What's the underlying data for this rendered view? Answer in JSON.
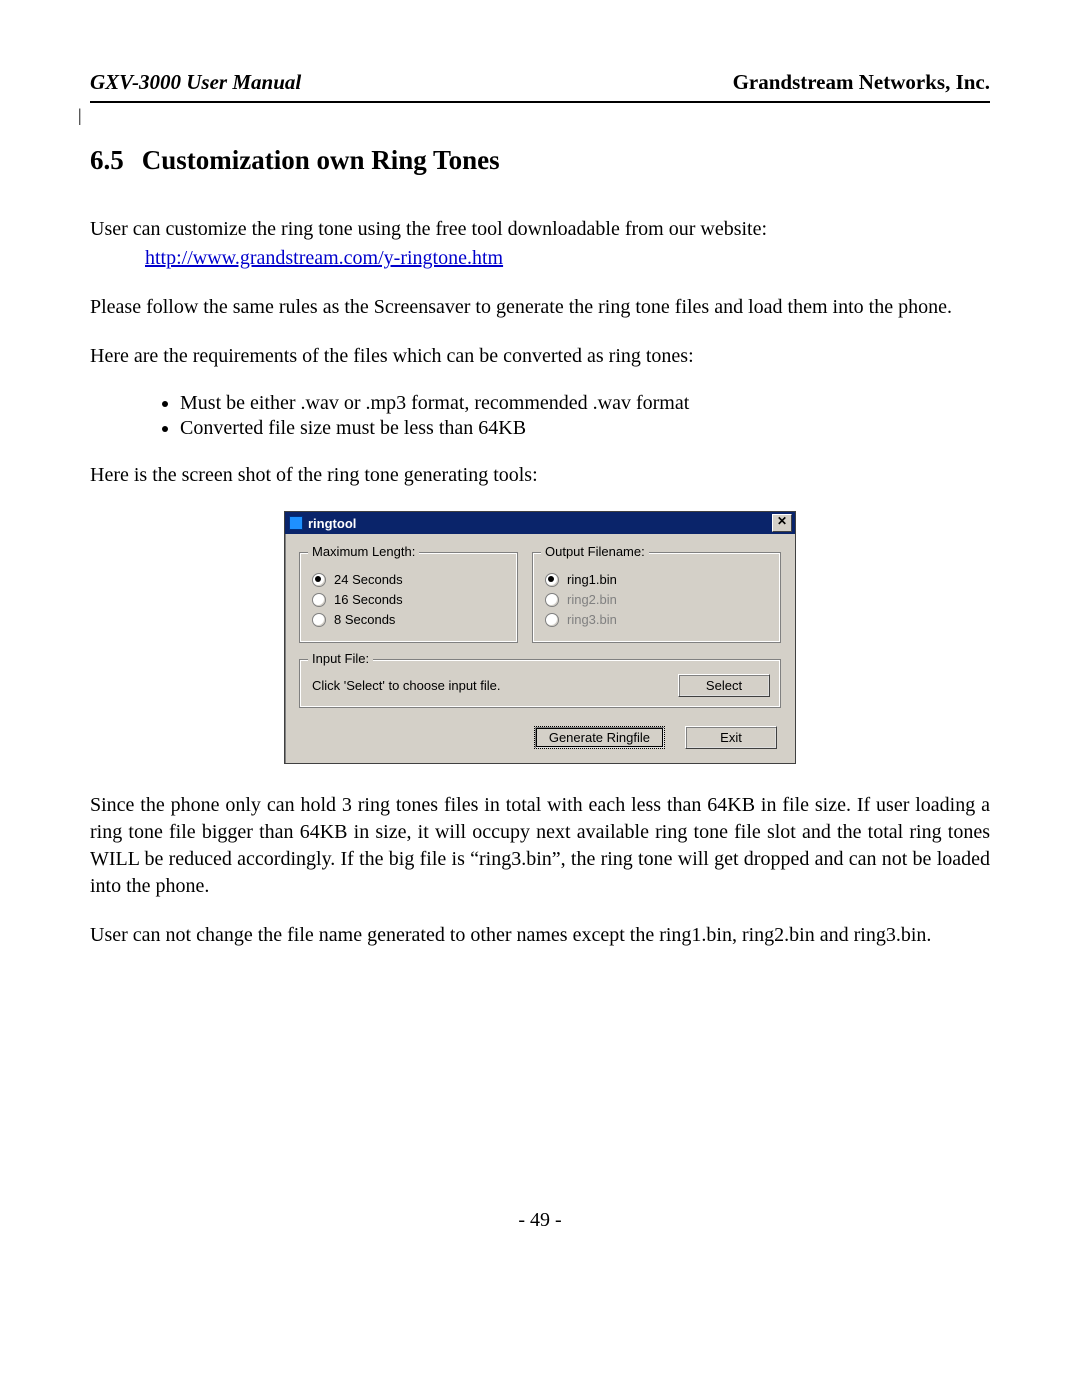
{
  "header": {
    "left": "GXV-3000 User Manual",
    "right": "Grandstream Networks, Inc."
  },
  "section": {
    "number": "6.5",
    "title": "Customization own Ring Tones"
  },
  "paragraphs": {
    "intro": "User can customize the ring tone using the free tool downloadable from our website:",
    "link_text": "http://www.grandstream.com/y-ringtone.htm",
    "link_href": "http://www.grandstream.com/y-ringtone.htm",
    "rules": "Please follow the same rules as the Screensaver to generate the ring tone files and load them into the phone.",
    "req_intro": "Here are the requirements of the files which can be converted as ring tones:",
    "req1": "Must be either .wav or .mp3 format, recommended .wav format",
    "req2": "Converted file size must be less than 64KB",
    "screenshot_intro": "Here is the screen shot of the ring tone generating tools:",
    "after1": "Since the phone only can hold 3 ring tones files in total with each less than 64KB in file size. If user loading a ring tone file bigger than 64KB in size, it will occupy next available ring tone file slot and the total ring tones WILL be reduced accordingly. If the big file is “ring3.bin”, the ring tone will get dropped and can not be loaded into the phone.",
    "after2": "User can not change the file name generated to other names except the ring1.bin, ring2.bin and ring3.bin."
  },
  "dialog": {
    "title": "ringtool",
    "close_glyph": "✕",
    "group_maxlen": "Maximum Length:",
    "opt_24": "24 Seconds",
    "opt_16": "16 Seconds",
    "opt_8": "8 Seconds",
    "group_output": "Output Filename:",
    "out_ring1": "ring1.bin",
    "out_ring2": "ring2.bin",
    "out_ring3": "ring3.bin",
    "group_input": "Input File:",
    "input_hint": "Click 'Select' to choose input file.",
    "btn_select": "Select",
    "btn_generate": "Generate Ringfile",
    "btn_exit": "Exit"
  },
  "page_number": "- 49 -"
}
